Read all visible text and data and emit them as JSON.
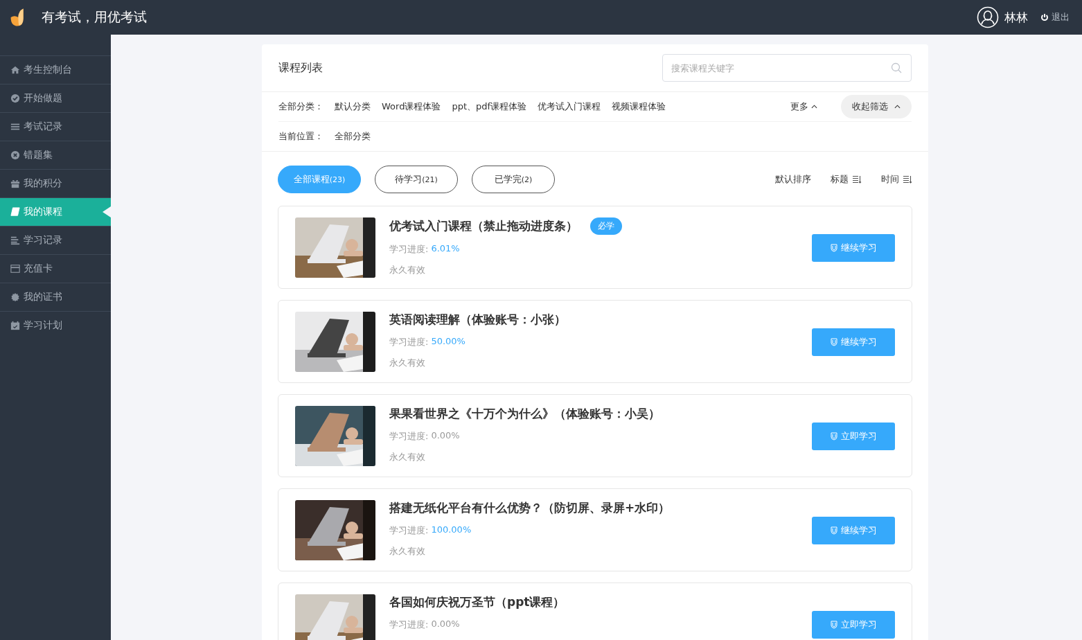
{
  "header": {
    "title": "有考试，用优考试",
    "user": "林林",
    "logout": "退出"
  },
  "sidebar": {
    "items": [
      {
        "label": "考生控制台",
        "selected": false
      },
      {
        "label": "开始做题",
        "selected": false
      },
      {
        "label": "考试记录",
        "selected": false
      },
      {
        "label": "错题集",
        "selected": false
      },
      {
        "label": "我的积分",
        "selected": false
      },
      {
        "label": "我的课程",
        "selected": true
      },
      {
        "label": "学习记录",
        "selected": false
      },
      {
        "label": "充值卡",
        "selected": false
      },
      {
        "label": "我的证书",
        "selected": false
      },
      {
        "label": "学习计划",
        "selected": false
      }
    ]
  },
  "panel": {
    "title": "课程列表",
    "search": {
      "placeholder": "搜索课程关键字"
    },
    "category_label": "全部分类：",
    "categories": [
      "默认分类",
      "Word课程体验",
      "ppt、pdf课程体验",
      "优考试入门课程",
      "视频课程体验"
    ],
    "more": "更多",
    "collapse": "收起筛选",
    "location_label": "当前位置：",
    "location": "全部分类",
    "tabs": [
      {
        "label": "全部课程",
        "count": "(23)",
        "selected": true
      },
      {
        "label": "待学习",
        "count": "(21)",
        "selected": false
      },
      {
        "label": "已学完",
        "count": "(2)",
        "selected": false
      }
    ],
    "sort": [
      {
        "label": "默认排序",
        "kind": "plain"
      },
      {
        "label": "标题",
        "kind": "icon"
      },
      {
        "label": "时间",
        "kind": "icon"
      }
    ],
    "courses": [
      {
        "title": "优考试入门课程（禁止拖动进度条）",
        "badge": "必学",
        "progress_label": "学习进度:",
        "progress": "6.01%",
        "started": true,
        "validity": "永久有效",
        "action": "继续学习"
      },
      {
        "title": "英语阅读理解（体验账号：小张）",
        "progress_label": "学习进度:",
        "progress": "50.00%",
        "started": true,
        "validity": "永久有效",
        "action": "继续学习"
      },
      {
        "title": "果果看世界之《十万个为什么》（体验账号：小吴）",
        "progress_label": "学习进度:",
        "progress": "0.00%",
        "started": false,
        "validity": "永久有效",
        "action": "立即学习"
      },
      {
        "title": "搭建无纸化平台有什么优势？（防切屏、录屏+水印）",
        "progress_label": "学习进度:",
        "progress": "100.00%",
        "started": true,
        "validity": "永久有效",
        "action": "继续学习"
      },
      {
        "title": "各国如何庆祝万圣节（ppt课程）",
        "progress_label": "学习进度:",
        "progress": "0.00%",
        "started": false,
        "action": "立即学习"
      }
    ]
  }
}
